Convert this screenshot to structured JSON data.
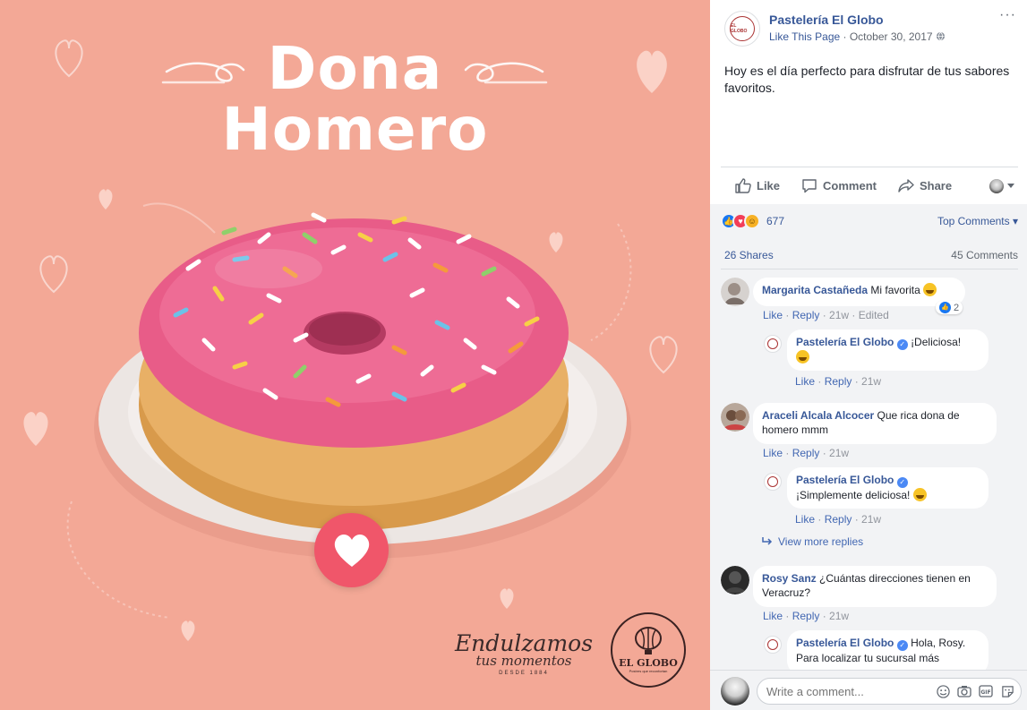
{
  "image": {
    "title_line1": "Dona",
    "title_line2": "Homero",
    "slogan_main": "Endulzamos",
    "slogan_sub": "tus momentos",
    "slogan_since": "DESDE 1884",
    "logo_text": "EL GLOBO",
    "logo_sub": "Postres que reconfortan",
    "colors": {
      "background": "#f3a896",
      "heart_button": "#f0566a",
      "icing": "#e85c88",
      "plate": "#ece6e3"
    }
  },
  "post": {
    "page_name": "Pastelería El Globo",
    "like_page": "Like This Page",
    "date": "October 30, 2017",
    "separator": " · ",
    "privacy_icon": "globe-icon",
    "avatar_text": "EL GLOBO",
    "more": "···",
    "text": "Hoy es el día perfecto para disfrutar de tus sabores favoritos."
  },
  "actions": {
    "like": "Like",
    "comment": "Comment",
    "share": "Share"
  },
  "stats": {
    "reactions_count": "677",
    "top_comments": "Top Comments ▾",
    "shares": "26 Shares",
    "comments": "45 Comments"
  },
  "comments": [
    {
      "author": "Margarita Castañeda",
      "text": "Mi favorita",
      "like": "Like",
      "reply": "Reply",
      "time": "21w",
      "edited": "Edited",
      "likes": "2",
      "replies": [
        {
          "author": "Pastelería El Globo",
          "text": "¡Deliciosa!",
          "like": "Like",
          "reply": "Reply",
          "time": "21w"
        }
      ]
    },
    {
      "author": "Araceli Alcala Alcocer",
      "text": "Que rica dona de homero mmm",
      "like": "Like",
      "reply": "Reply",
      "time": "21w",
      "replies": [
        {
          "author": "Pastelería El Globo",
          "text": "¡Simplemente deliciosa!",
          "like": "Like",
          "reply": "Reply",
          "time": "21w"
        }
      ],
      "view_more": "View more replies"
    },
    {
      "author": "Rosy Sanz",
      "text": "¿Cuántas direcciones tienen en Veracruz?",
      "like": "Like",
      "reply": "Reply",
      "time": "21w",
      "replies": [
        {
          "author": "Pastelería El Globo",
          "text": "Hola, Rosy. Para localizar tu sucursal más"
        }
      ]
    }
  ],
  "write": {
    "placeholder": "Write a comment..."
  },
  "colors": {
    "link": "#385898",
    "action_link": "#4267b2",
    "meta_gray": "#90949c",
    "panel_bg": "#f2f3f5"
  }
}
